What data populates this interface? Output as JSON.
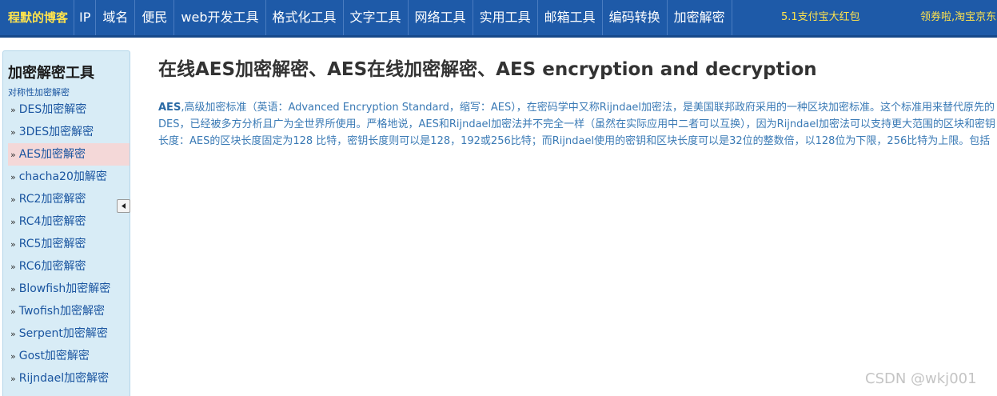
{
  "nav": {
    "items": [
      {
        "label": "程默的博客",
        "name": "nav-item-blog"
      },
      {
        "label": "IP",
        "name": "nav-item-ip"
      },
      {
        "label": "域名",
        "name": "nav-item-domain"
      },
      {
        "label": "便民",
        "name": "nav-item-convenience"
      },
      {
        "label": "web开发工具",
        "name": "nav-item-web-dev-tools"
      },
      {
        "label": "格式化工具",
        "name": "nav-item-format-tools"
      },
      {
        "label": "文字工具",
        "name": "nav-item-text-tools"
      },
      {
        "label": "网络工具",
        "name": "nav-item-network-tools"
      },
      {
        "label": "实用工具",
        "name": "nav-item-utility-tools"
      },
      {
        "label": "邮箱工具",
        "name": "nav-item-email-tools"
      },
      {
        "label": "编码转换",
        "name": "nav-item-encoding"
      },
      {
        "label": "加密解密",
        "name": "nav-item-crypto"
      }
    ],
    "promo1": "5.1支付宝大红包",
    "promo2": "领券啦,淘宝京东"
  },
  "sidebar": {
    "title": "加密解密工具",
    "subtitle": "对称性加密解密",
    "items": [
      {
        "label": "DES加密解密",
        "active": false
      },
      {
        "label": "3DES加密解密",
        "active": false
      },
      {
        "label": "AES加密解密",
        "active": true
      },
      {
        "label": "chacha20加解密",
        "active": false
      },
      {
        "label": "RC2加密解密",
        "active": false
      },
      {
        "label": "RC4加密解密",
        "active": false
      },
      {
        "label": "RC5加密解密",
        "active": false
      },
      {
        "label": "RC6加密解密",
        "active": false
      },
      {
        "label": "Blowfish加密解密",
        "active": false
      },
      {
        "label": "Twofish加密解密",
        "active": false
      },
      {
        "label": "Serpent加密解密",
        "active": false
      },
      {
        "label": "Gost加密解密",
        "active": false
      },
      {
        "label": "Rijndael加密解密",
        "active": false
      }
    ],
    "collapse_icon": "triangle-left-icon"
  },
  "main": {
    "title": "在线AES加密解密、AES在线加密解密、AES encryption and decryption",
    "desc_term": "AES",
    "desc_body": ",高级加密标准（英语：Advanced Encryption Standard，缩写：AES），在密码学中又称Rijndael加密法，是美国联邦政府采用的一种区块加密标准。这个标准用来替代原先的DES，已经被多方分析且广为全世界所使用。严格地说，AES和Rijndael加密法并不完全一样（虽然在实际应用中二者可以互换），因为Rijndael加密法可以支持更大范围的区块和密钥长度：AES的区块长度固定为128 比特，密钥长度则可以是128，192或256比特；而Rijndael使用的密钥和区块长度可以是32位的整数倍，以128位为下限，256比特为上限。包括AES-ECB,AES-CBC,AES-CTR,AES-OFB,AES-CFB"
  },
  "watermark": "CSDN @wkj001",
  "colors": {
    "nav_bg": "#1e5aa8",
    "brand_text": "#ffe34d",
    "sidebar_bg": "#d8ecf6",
    "active_item_bg": "#f4d8d8",
    "link": "#1a55a0"
  }
}
